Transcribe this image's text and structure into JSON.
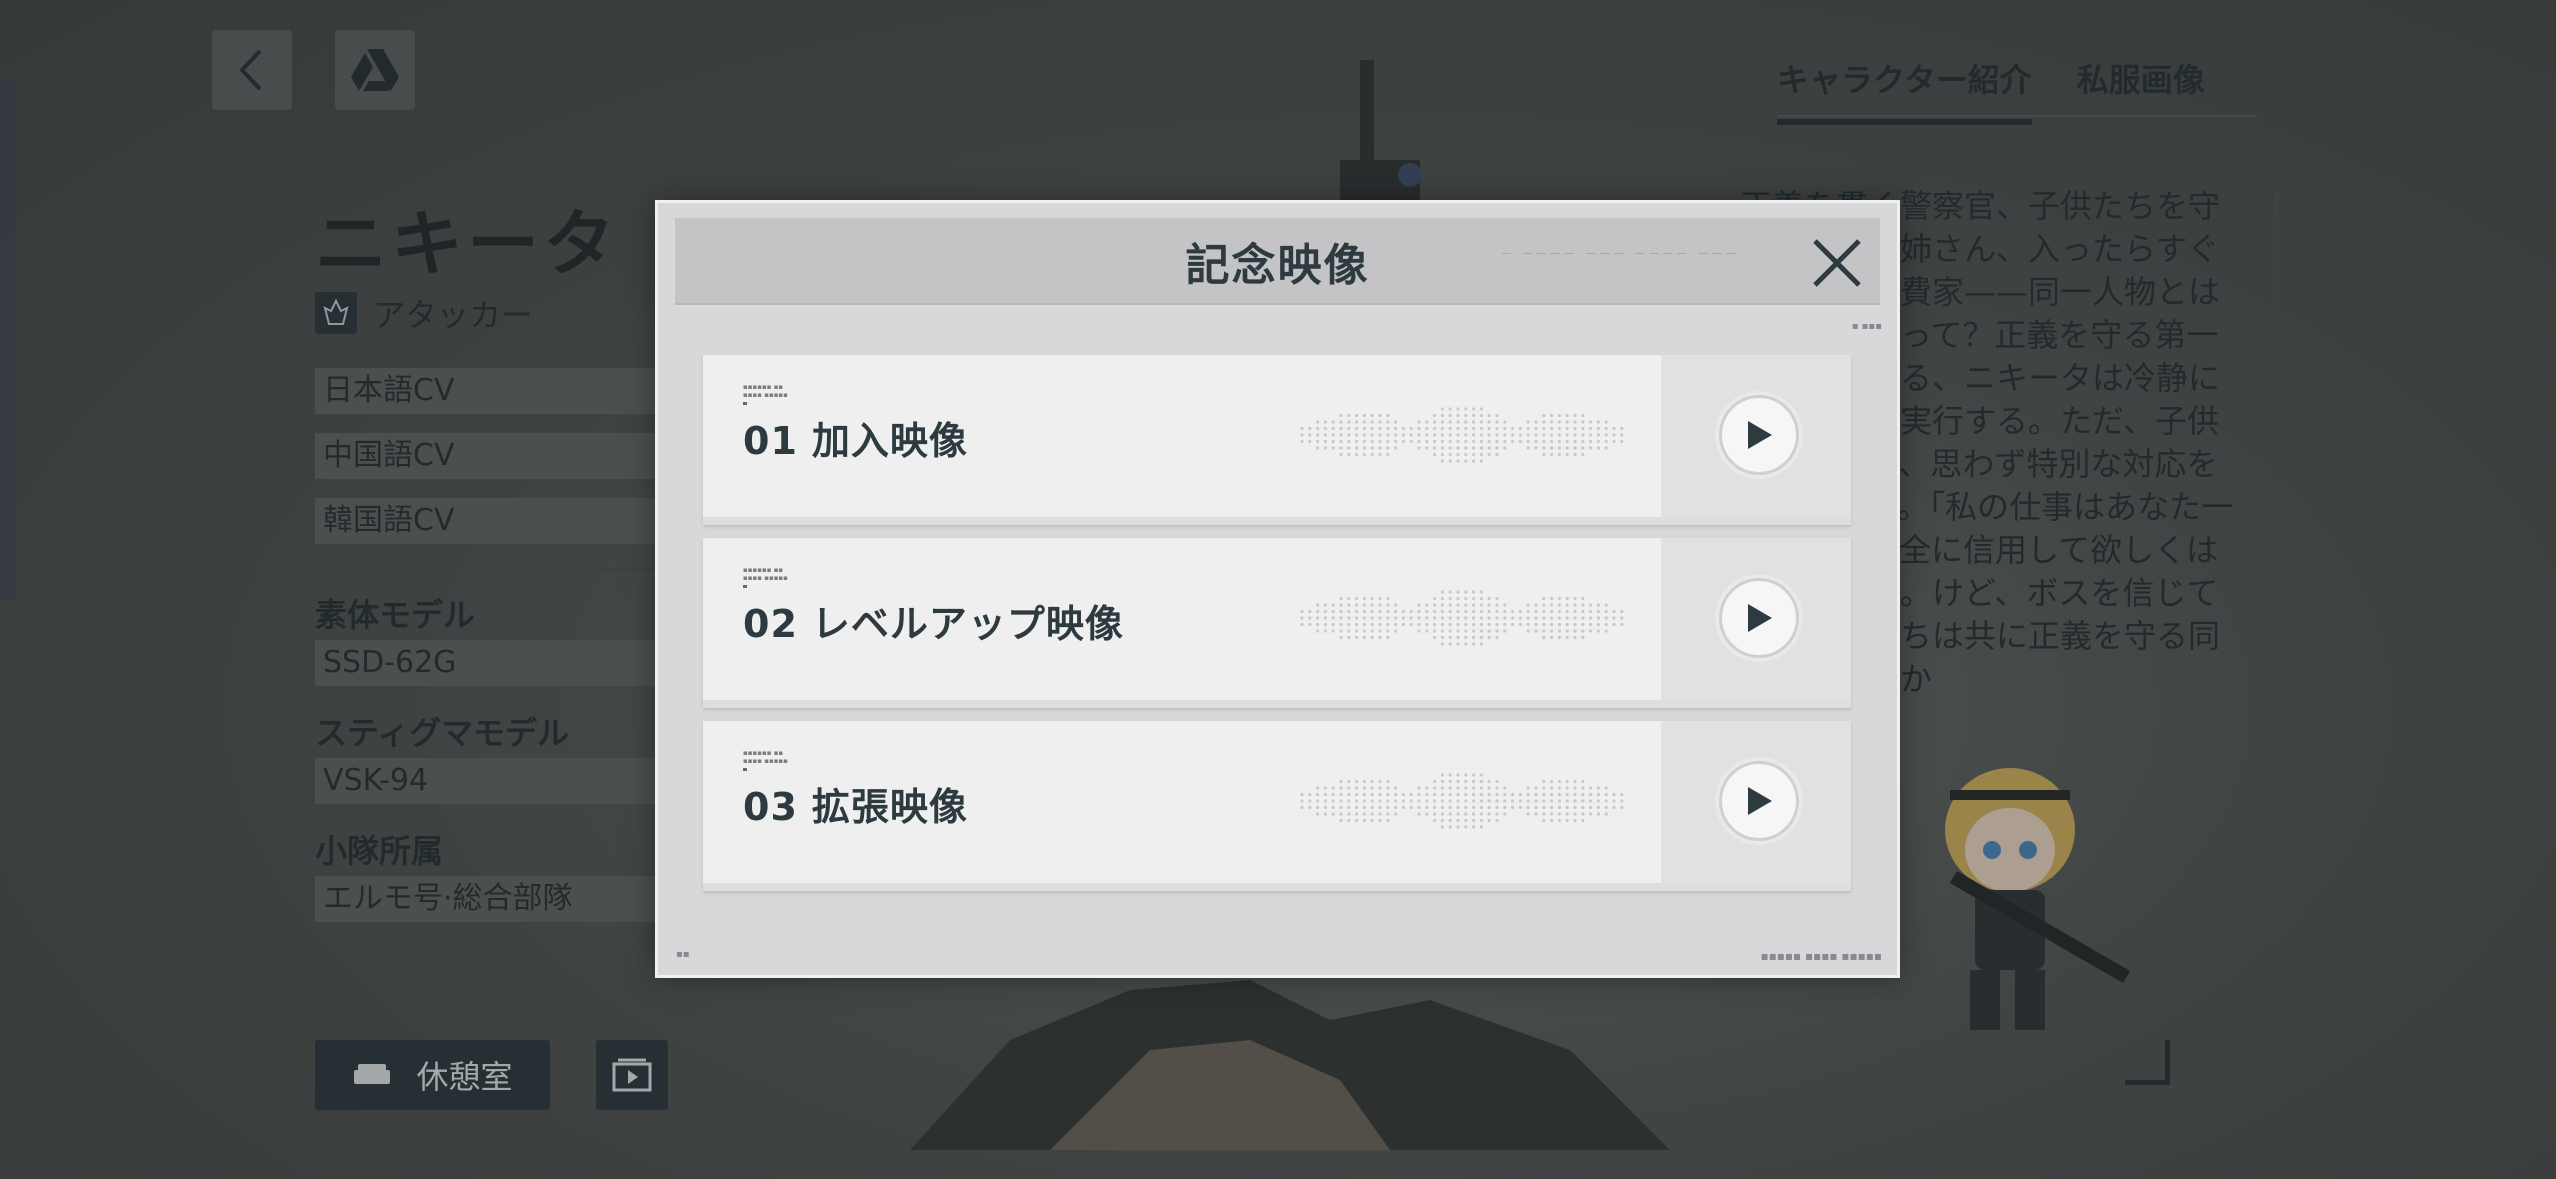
{
  "character": {
    "name": "ニキータ",
    "role": "アタッカー",
    "cv": [
      "日本語CV",
      "中国語CV",
      "韓国語CV"
    ],
    "body_model_label": "素体モデル",
    "body_model_value": "SSD-62G",
    "stigma_label": "スティグマモデル",
    "stigma_value": "VSK-94",
    "squad_label": "小隊所属",
    "squad_value": "エルモ号·総合部隊"
  },
  "buttons": {
    "lounge": "休憩室"
  },
  "tabs": [
    "キャラクター紹介",
    "私服画像"
  ],
  "description": "正義を貫く警察官、子供たちを守る優しいお姉さん、入ったらすぐ散財する浪費家——同一人物とは思えないだって？正義を守る第一線で活躍する、ニキータは冷静に法の原則を実行する。ただ、子供に対しては、思わず特別な対応をしてしまう。「私の仕事はあなた一人として完全に信用して欲しくはない、とね。けど、ボスを信じてるよ。私たちは共に正義を守る同志なのですか",
  "modal": {
    "title": "記念映像",
    "items": [
      {
        "num": "01",
        "label": "加入映像"
      },
      {
        "num": "02",
        "label": "レベルアップ映像"
      },
      {
        "num": "03",
        "label": "拡張映像"
      }
    ]
  },
  "colors": {
    "dark_panel": "#25333a",
    "modal_bg": "#d8d8da",
    "item_bg": "#efefef",
    "text_dark": "#2d3a40"
  }
}
